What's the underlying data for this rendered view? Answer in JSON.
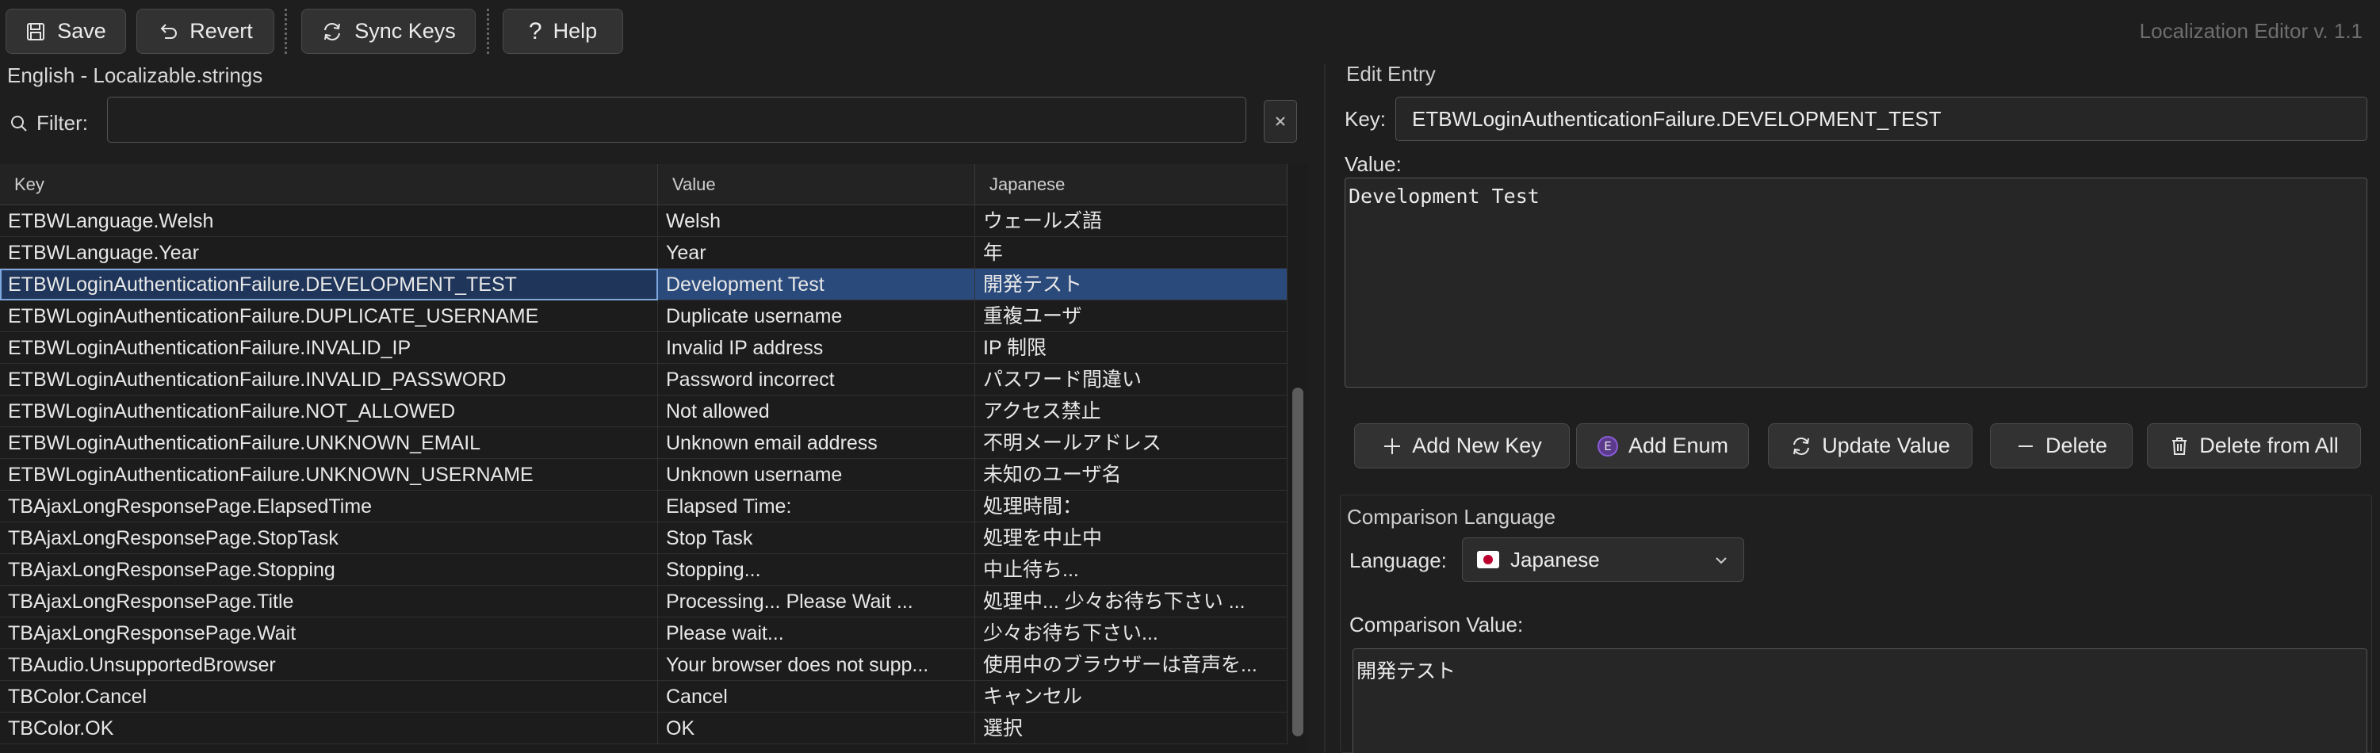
{
  "app_title": "Localization Editor v. 1.1",
  "toolbar": {
    "save": {
      "label": "Save",
      "icon": "save-icon"
    },
    "revert": {
      "label": "Revert",
      "icon": "undo-icon"
    },
    "sync": {
      "label": "Sync Keys",
      "icon": "sync-icon"
    },
    "help": {
      "label": "Help",
      "icon": "question-icon"
    }
  },
  "left_panel": {
    "title": "English - Localizable.strings",
    "filter_label": "Filter:",
    "filter_value": "",
    "table": {
      "columns": [
        "Key",
        "Value",
        "Japanese"
      ],
      "rows": [
        [
          "ETBWLanguage.Welsh",
          "Welsh",
          "ウェールズ語"
        ],
        [
          "ETBWLanguage.Year",
          "Year",
          "年"
        ],
        [
          "ETBWLoginAuthenticationFailure.DEVELOPMENT_TEST",
          "Development Test",
          "開発テスト"
        ],
        [
          "ETBWLoginAuthenticationFailure.DUPLICATE_USERNAME",
          "Duplicate username",
          "重複ユーザ"
        ],
        [
          "ETBWLoginAuthenticationFailure.INVALID_IP",
          "Invalid IP address",
          "IP 制限"
        ],
        [
          "ETBWLoginAuthenticationFailure.INVALID_PASSWORD",
          "Password incorrect",
          "パスワード間違い"
        ],
        [
          "ETBWLoginAuthenticationFailure.NOT_ALLOWED",
          "Not allowed",
          "アクセス禁止"
        ],
        [
          "ETBWLoginAuthenticationFailure.UNKNOWN_EMAIL",
          "Unknown email address",
          "不明メールアドレス"
        ],
        [
          "ETBWLoginAuthenticationFailure.UNKNOWN_USERNAME",
          "Unknown username",
          "未知のユーザ名"
        ],
        [
          "TBAjaxLongResponsePage.ElapsedTime",
          "Elapsed Time:",
          "処理時間："
        ],
        [
          "TBAjaxLongResponsePage.StopTask",
          "Stop Task",
          "処理を中止中"
        ],
        [
          "TBAjaxLongResponsePage.Stopping",
          "Stopping...",
          "中止待ち..."
        ],
        [
          "TBAjaxLongResponsePage.Title",
          "Processing... Please Wait ...",
          "処理中... 少々お待ち下さい ..."
        ],
        [
          "TBAjaxLongResponsePage.Wait",
          "Please wait...",
          "少々お待ち下さい..."
        ],
        [
          "TBAudio.UnsupportedBrowser",
          "Your browser does not supp...",
          "使用中のブラウザーは音声を..."
        ],
        [
          "TBColor.Cancel",
          "Cancel",
          "キャンセル"
        ],
        [
          "TBColor.OK",
          "OK",
          "選択"
        ]
      ],
      "selected_row": 2
    }
  },
  "edit_entry": {
    "title": "Edit Entry",
    "key_label": "Key:",
    "key_value": "ETBWLoginAuthenticationFailure.DEVELOPMENT_TEST",
    "value_label": "Value:",
    "value_text": "Development Test",
    "buttons": {
      "add_key": "Add New Key",
      "add_enum": "Add Enum",
      "update": "Update Value",
      "delete": "Delete",
      "delete_all": "Delete from All"
    }
  },
  "comparison": {
    "title": "Comparison Language",
    "language_label": "Language:",
    "language_value": "Japanese",
    "value_label": "Comparison Value:",
    "value_text": "開発テスト"
  },
  "colors": {
    "background": "#1e1e1e",
    "selected_row": "#2b4a7c",
    "accent_enum": "#8a5cd6"
  }
}
